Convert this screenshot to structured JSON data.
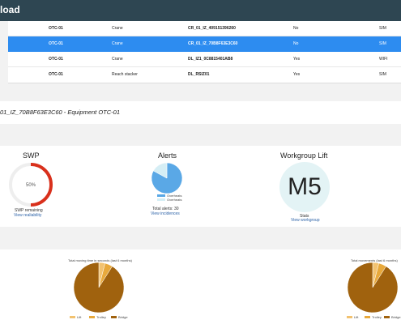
{
  "app": {
    "title_fragment": "load"
  },
  "table": {
    "rows": [
      {
        "equipment": "OTC-01",
        "type": "Crane",
        "id": "CR_01_IZ_409151396260",
        "flag": "No",
        "conn": "SIM",
        "selected": false
      },
      {
        "equipment": "OTC-01",
        "type": "Crane",
        "id": "CR_01_IZ_70B8F63E3C60",
        "flag": "No",
        "conn": "SIM",
        "selected": true
      },
      {
        "equipment": "OTC-01",
        "type": "Crane",
        "id": "DL_IZ1_0C8815401AB8",
        "flag": "Yes",
        "conn": "WIFI",
        "selected": false
      },
      {
        "equipment": "OTC-01",
        "type": "Reach stacker",
        "id": "DL_RSIZ01",
        "flag": "Yes",
        "conn": "SIM",
        "selected": false
      }
    ]
  },
  "equipment_header": "01_IZ_70B8F63E3C60 - Equipment OTC-01",
  "swp": {
    "title": "SWP",
    "value": "50%",
    "value_fraction": 0.5,
    "caption": "SWP remaining",
    "link": "View realiability",
    "color": "#d9301c"
  },
  "alerts": {
    "title": "Alerts",
    "legend": [
      "Overheats",
      "Overheats"
    ],
    "total": "Total alerts: 30",
    "link": "View incidences",
    "colors": [
      "#5aa8e6",
      "#d5eef5"
    ]
  },
  "workgroup": {
    "title": "Workgroup Lift",
    "value": "M5",
    "caption": "Stats",
    "link": "View workgroup"
  },
  "charts": {
    "left_title": "Total moving time in seconds (last 6 months)",
    "right_title": "Total movements (last 6 months)",
    "legend": [
      "Lift",
      "Trolley",
      "Bridge"
    ],
    "colors": [
      "#f2c270",
      "#e8a93c",
      "#a0620e"
    ]
  },
  "chart_data": [
    {
      "type": "pie",
      "title": "",
      "categories": [],
      "values": [
        0.83,
        0.17
      ],
      "colors": [
        "#5aa8e6",
        "#d5eef5"
      ]
    },
    {
      "type": "pie",
      "title": "Total moving time in seconds (last 6 months)",
      "categories": [
        "Lift",
        "Trolley",
        "Bridge"
      ],
      "values": [
        4,
        5,
        91
      ],
      "colors": [
        "#f2c270",
        "#e8a93c",
        "#a0620e"
      ]
    },
    {
      "type": "pie",
      "title": "Total movements (last 6 months)",
      "categories": [
        "Lift",
        "Trolley",
        "Bridge"
      ],
      "values": [
        4,
        5,
        91
      ],
      "colors": [
        "#f2c270",
        "#e8a93c",
        "#a0620e"
      ]
    }
  ]
}
